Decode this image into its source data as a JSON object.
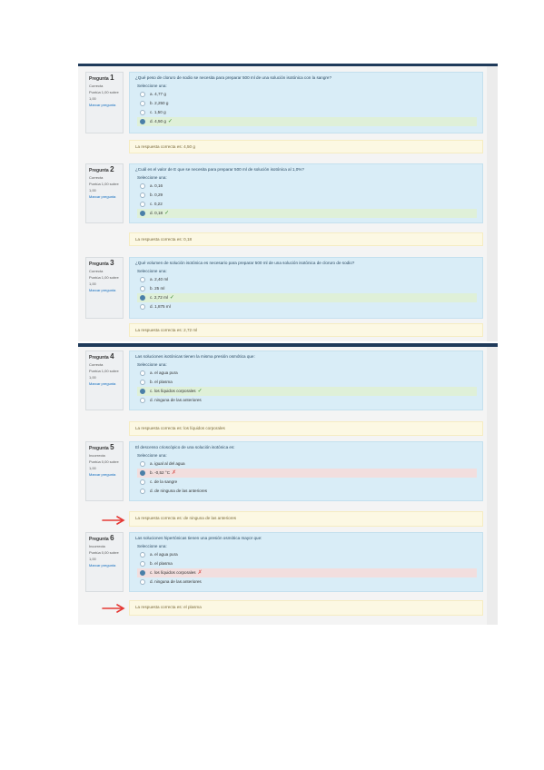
{
  "questions": [
    {
      "label": "Pregunta",
      "number": "1",
      "status": "Correcta",
      "points": "Puntúa 1,00 sobre 1,00",
      "flag": "Marcar pregunta",
      "text": "¿Qué peso de cloruro de sodio se necesita para preparar 500 ml de una solución isotónica con la sangre?",
      "prompt": "Seleccione una:",
      "options": [
        {
          "text": "a. 4,77 g",
          "state": "none"
        },
        {
          "text": "b. 2,250 g",
          "state": "none"
        },
        {
          "text": "c. 1,50 g",
          "state": "none"
        },
        {
          "text": "d. 4,50 g",
          "state": "correct"
        }
      ],
      "feedback": "La respuesta correcta es: 4,50 g"
    },
    {
      "label": "Pregunta",
      "number": "2",
      "status": "Correcta",
      "points": "Puntúa 1,00 sobre 1,00",
      "flag": "Marcar pregunta",
      "text": "¿Cuál es el valor de E que se necesita para preparar 500 ml de solución isotónica al 1,0%?",
      "prompt": "Seleccione una:",
      "options": [
        {
          "text": "a. 0,16",
          "state": "none"
        },
        {
          "text": "b. 0,29",
          "state": "none"
        },
        {
          "text": "c. 0,22",
          "state": "none"
        },
        {
          "text": "d. 0,18",
          "state": "correct"
        }
      ],
      "feedback": "La respuesta correcta es: 0,18"
    },
    {
      "label": "Pregunta",
      "number": "3",
      "status": "Correcta",
      "points": "Puntúa 1,00 sobre 1,00",
      "flag": "Marcar pregunta",
      "text": "¿Qué volumen de solución isotónica es necesario para preparar 500 ml de una solución isotónica de cloruro de sodio?",
      "prompt": "Seleccione una:",
      "options": [
        {
          "text": "a. 2,40 ml",
          "state": "none"
        },
        {
          "text": "b. 25 ml",
          "state": "none"
        },
        {
          "text": "c. 2,72 ml",
          "state": "correct"
        },
        {
          "text": "d. 1,875 ml",
          "state": "none"
        }
      ],
      "feedback": "La respuesta correcta es: 2,72 ml"
    },
    {
      "label": "Pregunta",
      "number": "4",
      "status": "Correcta",
      "points": "Puntúa 1,00 sobre 1,00",
      "flag": "Marcar pregunta",
      "text": "Las soluciones isotónicas tienen la misma presión osmótica que:",
      "prompt": "Seleccione una:",
      "options": [
        {
          "text": "a. el agua pura",
          "state": "none"
        },
        {
          "text": "b. el plasma",
          "state": "none"
        },
        {
          "text": "c. los líquidos corporales",
          "state": "correct"
        },
        {
          "text": "d. ninguna de las anteriores",
          "state": "none"
        }
      ],
      "feedback": "La respuesta correcta es: los líquidos corporales"
    },
    {
      "label": "Pregunta",
      "number": "5",
      "status": "Incorrecta",
      "points": "Puntúa 0,00 sobre 1,00",
      "flag": "Marcar pregunta",
      "text": "El descenso crioscópico de una solución isotónica es:",
      "prompt": "Seleccione una:",
      "options": [
        {
          "text": "a. igual al del agua",
          "state": "none"
        },
        {
          "text": "b. -0,52 °C",
          "state": "incorrect"
        },
        {
          "text": "c. de la sangre",
          "state": "none"
        },
        {
          "text": "d. de ninguna de las anteriores",
          "state": "none"
        }
      ],
      "feedback": "La respuesta correcta es: de ninguna de las anteriores"
    },
    {
      "label": "Pregunta",
      "number": "6",
      "status": "Incorrecta",
      "points": "Puntúa 0,00 sobre 1,00",
      "flag": "Marcar pregunta",
      "text": "Las soluciones hipertónicas tienen una presión osmótica mayor que:",
      "prompt": "Seleccione una:",
      "options": [
        {
          "text": "a. el agua pura",
          "state": "none"
        },
        {
          "text": "b. el plasma",
          "state": "none"
        },
        {
          "text": "c. los líquidos corporales",
          "state": "incorrect"
        },
        {
          "text": "d. ninguna de las anteriores",
          "state": "none"
        }
      ],
      "feedback": "La respuesta correcta es: el plasma"
    }
  ],
  "marks": {
    "correct": "✓",
    "incorrect": "✗"
  },
  "colors": {
    "header": "#1f3a5a",
    "question_bg": "#d9edf7",
    "feedback_bg": "#fcf8e3",
    "correct_bg": "#dff0d8",
    "incorrect_bg": "#f2dede",
    "annotation": "#e53935"
  }
}
